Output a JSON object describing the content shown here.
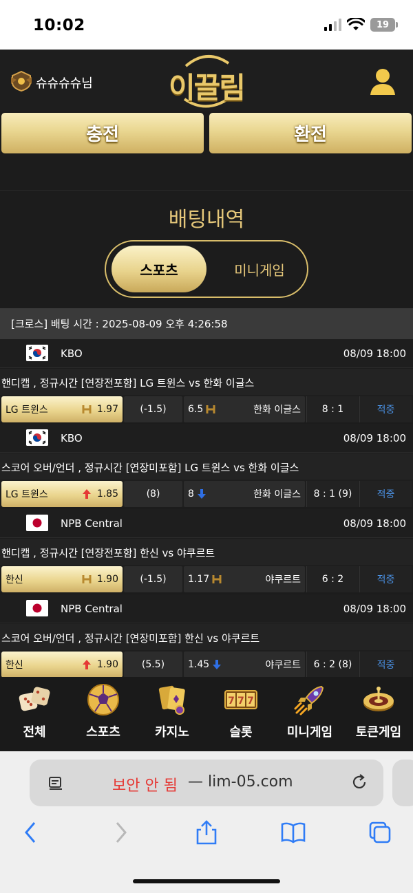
{
  "status_bar": {
    "time": "10:02",
    "battery": "19"
  },
  "header": {
    "username": "슈슈슈슈님",
    "logo_text": "이끌림"
  },
  "buttons": {
    "charge": "충전",
    "exchange": "환전"
  },
  "section_title": "배팅내역",
  "tabs": {
    "sports": "스포츠",
    "mini": "미니게임"
  },
  "bet_header": "[크로스] 배팅 시간 : 2025-08-09 오후 4:26:58",
  "bets": [
    {
      "league": "KBO",
      "flag": "korea",
      "time": "08/09 18:00",
      "market": "핸디캡 , 정규시간 [연장전포함] LG 트윈스  vs  한화 이글스",
      "home": "LG 트윈스",
      "home_odd": "1.97",
      "home_icon": "handicap-icon",
      "line": "(-1.5)",
      "away_odd": "6.5",
      "away_icon": "handicap-icon",
      "away": "한화 이글스",
      "score": "8 : 1",
      "result": "적중"
    },
    {
      "league": "KBO",
      "flag": "korea",
      "time": "08/09 18:00",
      "market": "스코어 오버/언더 , 정규시간 [연장미포함] LG 트윈스  vs  한화 이글스",
      "home": "LG 트윈스",
      "home_odd": "1.85",
      "home_icon": "over-arrow-icon",
      "line": "(8)",
      "away_odd": "8",
      "away_icon": "under-arrow-icon",
      "away": "한화 이글스",
      "score": "8 : 1 (9)",
      "result": "적중"
    },
    {
      "league": "NPB Central",
      "flag": "japan",
      "time": "08/09 18:00",
      "market": "핸디캡 , 정규시간 [연장전포함] 한신  vs  야쿠르트",
      "home": "한신",
      "home_odd": "1.90",
      "home_icon": "handicap-icon",
      "line": "(-1.5)",
      "away_odd": "1.17",
      "away_icon": "handicap-icon",
      "away": "야쿠르트",
      "score": "6 : 2",
      "result": "적중"
    },
    {
      "league": "NPB Central",
      "flag": "japan",
      "time": "08/09 18:00",
      "market": "스코어 오버/언더 , 정규시간 [연장미포함] 한신  vs  야쿠르트",
      "home": "한신",
      "home_odd": "1.90",
      "home_icon": "over-arrow-icon",
      "line": "(5.5)",
      "away_odd": "1.45",
      "away_icon": "under-arrow-icon",
      "away": "야쿠르트",
      "score": "6 : 2 (8)",
      "result": "적중"
    }
  ],
  "bottom_nav": [
    {
      "label": "전체",
      "icon": "dice-icon"
    },
    {
      "label": "스포츠",
      "icon": "soccer-ball-icon"
    },
    {
      "label": "카지노",
      "icon": "cards-icon"
    },
    {
      "label": "슬롯",
      "icon": "slot-777-icon"
    },
    {
      "label": "미니게임",
      "icon": "rocket-icon"
    },
    {
      "label": "토큰게임",
      "icon": "roulette-icon"
    }
  ],
  "browser": {
    "warning": "보안 안 됨",
    "host": "— lim-05.com"
  },
  "colors": {
    "gold": "#e5c77a",
    "accent_blue": "#4a90e2",
    "bg": "#1c1c1c",
    "warning_red": "#e53935"
  }
}
